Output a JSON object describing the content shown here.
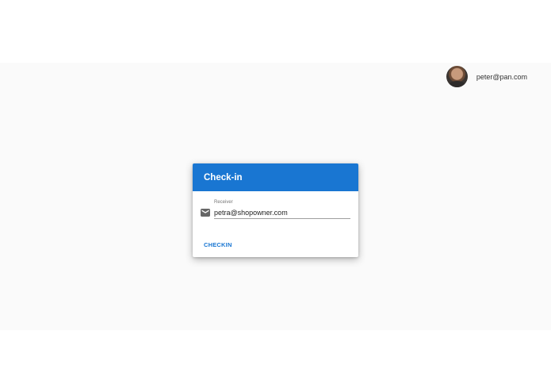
{
  "header": {
    "user_email": "peter@pan.com",
    "avatar_icon": "user-avatar"
  },
  "dialog": {
    "title": "Check-in",
    "receiver_label": "Receiver",
    "receiver_value": "petra@shopowner.com",
    "receiver_icon": "mail-icon",
    "checkin_label": "CHECKIN"
  },
  "colors": {
    "primary": "#1976d2",
    "background": "#fafafa"
  }
}
